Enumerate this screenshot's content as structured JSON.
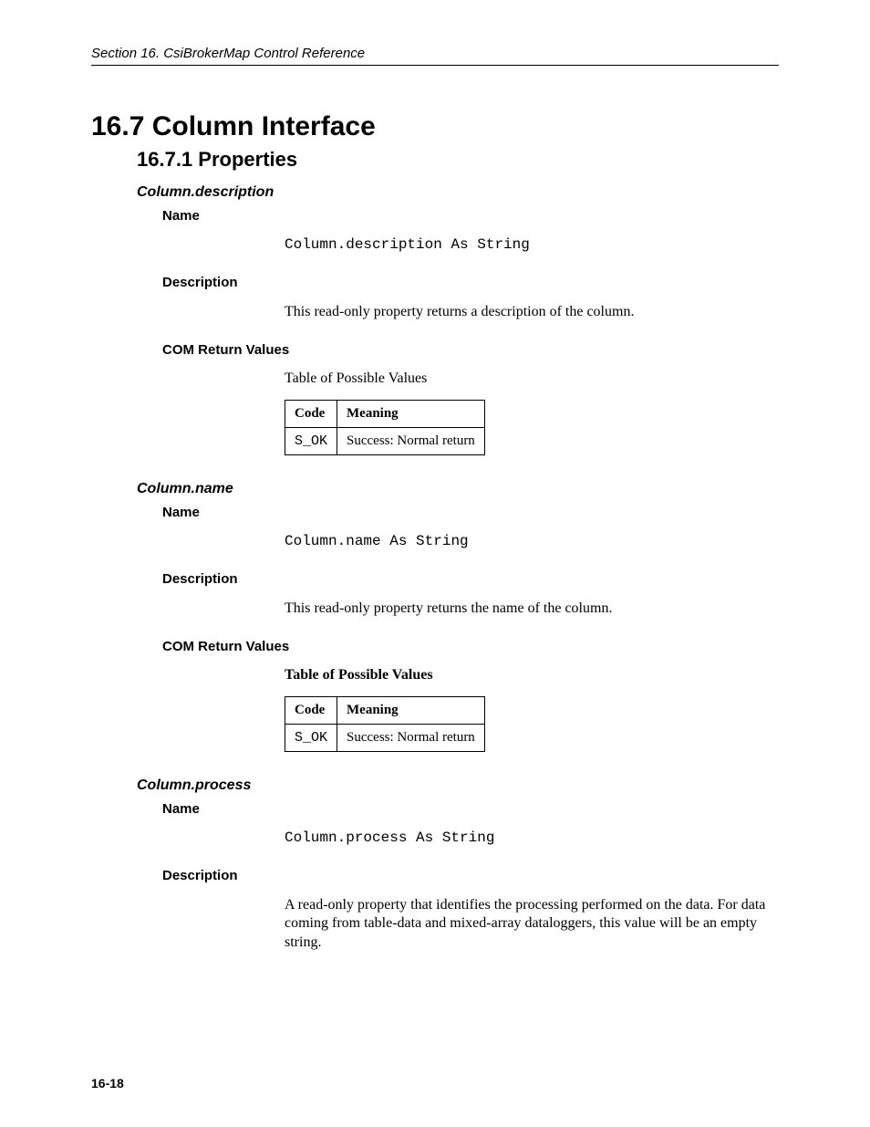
{
  "header": {
    "running": "Section 16.  CsiBrokerMap Control Reference"
  },
  "section": {
    "h1": "16.7  Column Interface",
    "h2": "16.7.1  Properties"
  },
  "props": {
    "description": {
      "title": "Column.description",
      "name_label": "Name",
      "code": "Column.description As String",
      "desc_label": "Description",
      "desc_text": "This read-only property returns a description of the column.",
      "com_label": "COM Return Values",
      "table_caption": "Table of Possible Values",
      "table": {
        "h_code": "Code",
        "h_meaning": "Meaning",
        "r0_code": "S_OK",
        "r0_meaning": "Success: Normal return"
      }
    },
    "name": {
      "title": "Column.name",
      "name_label": "Name",
      "code_mono": "Column.name",
      "code_rest": " As String",
      "desc_label": "Description",
      "desc_text": "This read-only property returns the name of the column.",
      "com_label": "COM Return Values",
      "table_caption": "Table of Possible Values",
      "table": {
        "h_code": "Code",
        "h_meaning": "Meaning",
        "r0_code": "S_OK",
        "r0_meaning": "Success: Normal return"
      }
    },
    "process": {
      "title": "Column.process",
      "name_label": "Name",
      "code": "Column.process As String",
      "desc_label": "Description",
      "desc_text": "A read-only property that identifies the processing performed on the data.  For data coming from table-data and mixed-array dataloggers, this value will be an empty string."
    }
  },
  "footer": {
    "page_number": "16-18"
  }
}
